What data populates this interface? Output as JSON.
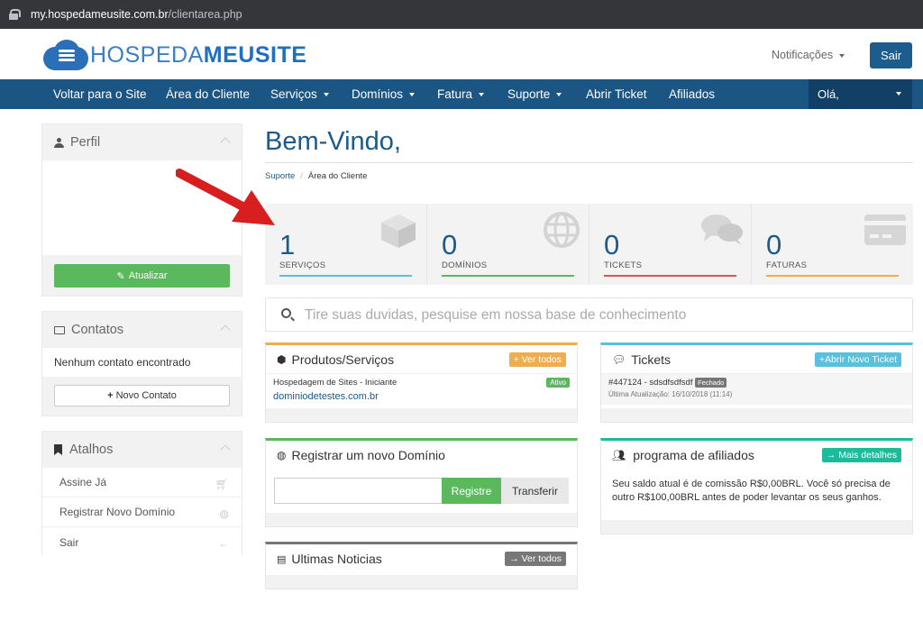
{
  "browser": {
    "url_host": "my.hospedameusite.com.br",
    "url_path": "/clientarea.php"
  },
  "header": {
    "logo_light": "HOSPEDA",
    "logo_bold": "MEUSITE",
    "notifications": "Notificações",
    "logout": "Sair"
  },
  "nav": {
    "items": [
      "Voltar para o Site",
      "Área do Cliente",
      "Serviços",
      "Domínios",
      "Fatura",
      "Suporte",
      "Abrir Ticket",
      "Afiliados"
    ],
    "greeting": "Olá,"
  },
  "sidebar": {
    "profile": {
      "title": "Perfil",
      "update_button": "Atualizar"
    },
    "contacts": {
      "title": "Contatos",
      "empty_text": "Nenhum contato encontrado",
      "new_button": "Novo Contato"
    },
    "shortcuts": {
      "title": "Atalhos",
      "items": [
        "Assine Já",
        "Registrar Novo Domínio",
        "Sair"
      ]
    }
  },
  "main": {
    "title": "Bem-Vindo,",
    "breadcrumb": [
      "Suporte",
      "Área do Cliente"
    ],
    "stats": [
      {
        "value": "1",
        "label": "SERVIÇOS",
        "color": "#5bc0de"
      },
      {
        "value": "0",
        "label": "DOMÍNIOS",
        "color": "#5cb85c"
      },
      {
        "value": "0",
        "label": "TICKETS",
        "color": "#d9534f"
      },
      {
        "value": "0",
        "label": "FATURAS",
        "color": "#f0ad4e"
      }
    ],
    "search_placeholder": "Tire suas duvidas, pesquise em nossa base de conhecimento"
  },
  "cards": {
    "products": {
      "title": "Produtos/Serviços",
      "view_all": "Ver todos",
      "item_name": "Hospedagem de Sites - Iniciante",
      "item_domain": "dominiodetestes.com.br",
      "status": "Ativo"
    },
    "tickets": {
      "title": "Tickets",
      "new_ticket": "Abrir Novo Ticket",
      "ticket_id": "#447124 - sdsdfsdfsdf",
      "ticket_status": "Fechado",
      "last_update": "Última Atualização: 16/10/2018 (11:14)"
    },
    "domain": {
      "title": "Registrar um novo Domínio",
      "register": "Registre",
      "transfer": "Transferir"
    },
    "affiliates": {
      "title": "programa de afiliados",
      "details": "Mais detalhes",
      "text": "Seu saldo atual é de comissão R$0,00BRL. Você só precisa de outro R$100,00BRL antes de poder levantar os seus ganhos."
    },
    "news": {
      "title": "Ultimas Noticias",
      "view_all": "Ver todos"
    }
  },
  "colors": {
    "nav_bg": "#1b5583",
    "brand": "#1b5a8a",
    "green": "#5cb85c",
    "orange": "#f0ad4e",
    "info": "#5bc0de",
    "arrow": "#d71f1f"
  }
}
